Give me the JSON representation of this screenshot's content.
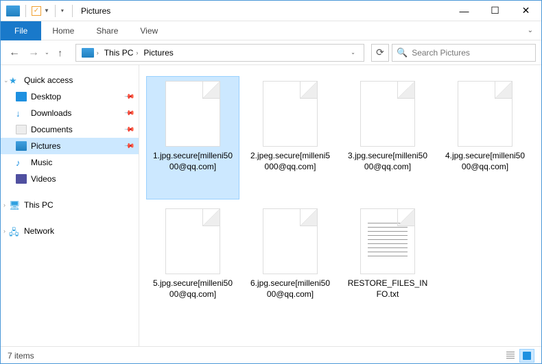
{
  "window": {
    "title": "Pictures"
  },
  "ribbon": {
    "file": "File",
    "tabs": [
      "Home",
      "Share",
      "View"
    ]
  },
  "breadcrumb": [
    "This PC",
    "Pictures"
  ],
  "search": {
    "placeholder": "Search Pictures"
  },
  "sidebar": {
    "quick_access": "Quick access",
    "items": [
      {
        "label": "Desktop",
        "pinned": true
      },
      {
        "label": "Downloads",
        "pinned": true
      },
      {
        "label": "Documents",
        "pinned": true
      },
      {
        "label": "Pictures",
        "pinned": true,
        "selected": true
      },
      {
        "label": "Music",
        "pinned": false
      },
      {
        "label": "Videos",
        "pinned": false
      }
    ],
    "this_pc": "This PC",
    "network": "Network"
  },
  "files": [
    {
      "name": "1.jpg.secure[milleni5000@qq.com]",
      "type": "file",
      "selected": true
    },
    {
      "name": "2.jpeg.secure[milleni5000@qq.com]",
      "type": "file"
    },
    {
      "name": "3.jpg.secure[milleni5000@qq.com]",
      "type": "file"
    },
    {
      "name": "4.jpg.secure[milleni5000@qq.com]",
      "type": "file"
    },
    {
      "name": "5.jpg.secure[milleni5000@qq.com]",
      "type": "file"
    },
    {
      "name": "6.jpg.secure[milleni5000@qq.com]",
      "type": "file"
    },
    {
      "name": "RESTORE_FILES_INFO.txt",
      "type": "txt"
    }
  ],
  "status": {
    "count": "7 items"
  }
}
